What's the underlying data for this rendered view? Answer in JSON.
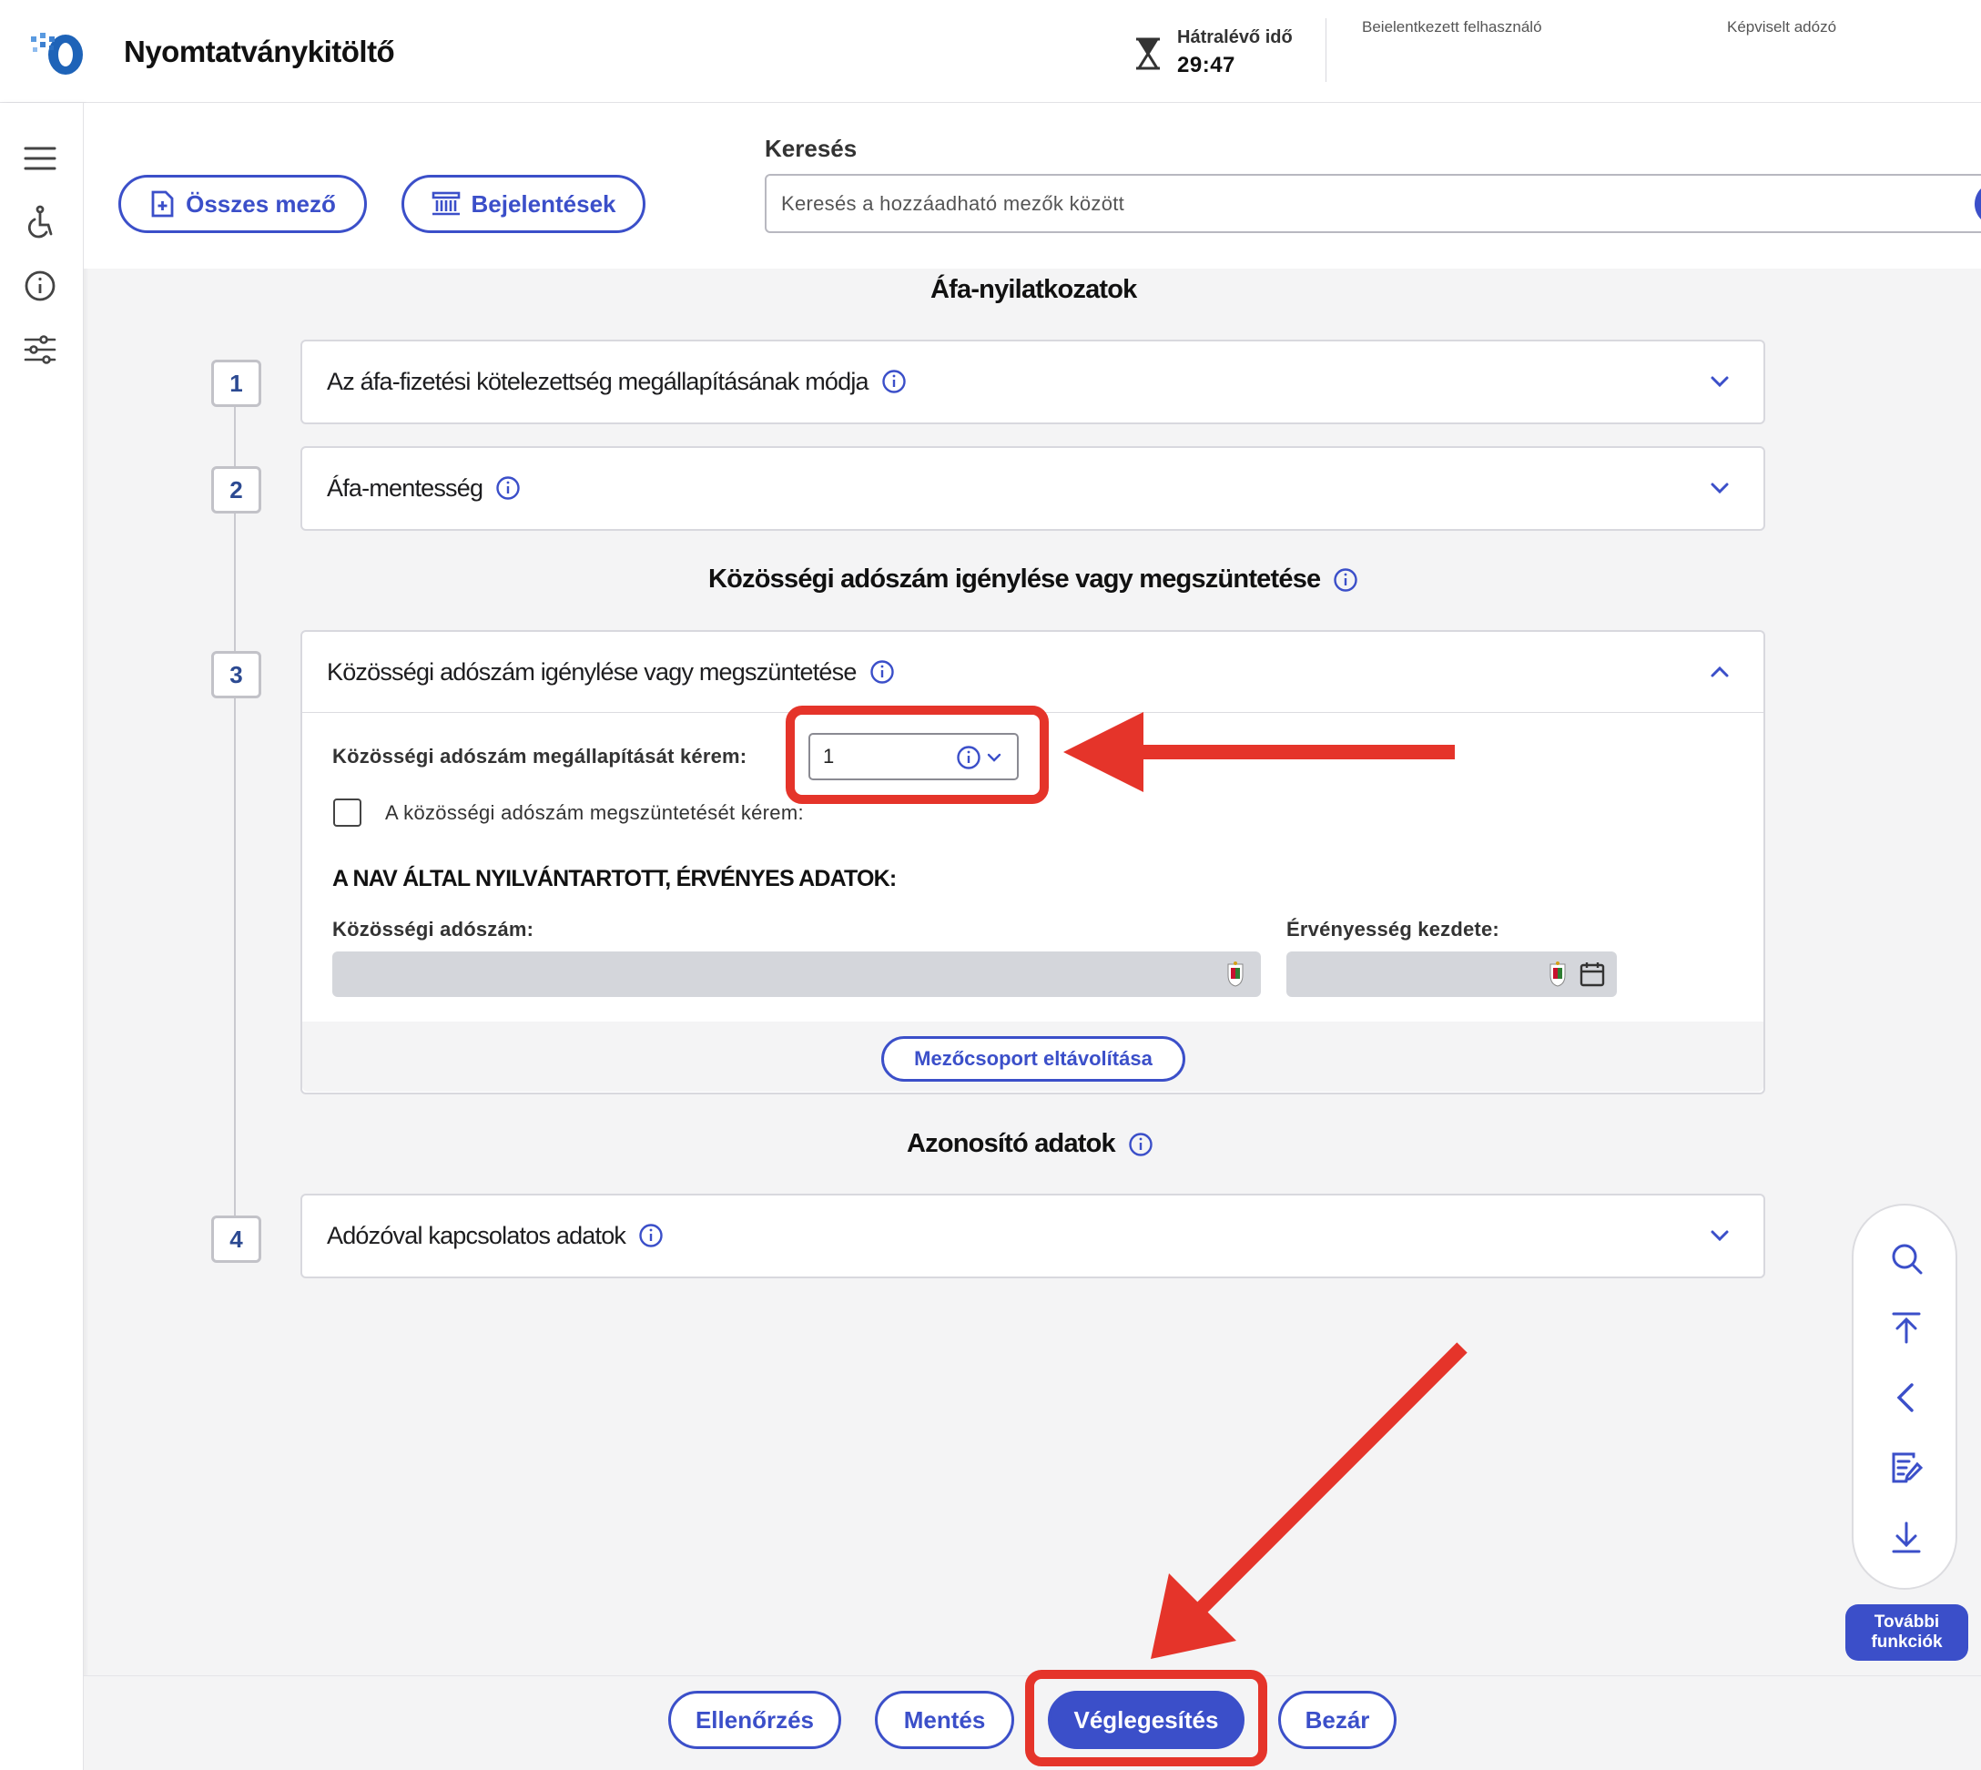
{
  "header": {
    "app_title": "Nyomtatványkitöltő",
    "timer_label": "Hátralévő idő",
    "timer_value": "29:47",
    "logged_in_user_label": "Beielentkezett felhasználó",
    "represented_taxpayer_label": "Képviselt adózó"
  },
  "sidebar": {
    "items": [
      {
        "icon": "menu-icon"
      },
      {
        "icon": "accessibility-icon"
      },
      {
        "icon": "info-icon"
      },
      {
        "icon": "settings-sliders-icon"
      }
    ]
  },
  "toolbar": {
    "all_fields_label": "Összes mező",
    "reports_label": "Bejelentések",
    "search_label": "Keresés",
    "search_placeholder": "Keresés a hozzáadható mezők között"
  },
  "content": {
    "section1_title": "Áfa-nyilatkozatok",
    "cards": [
      {
        "step": "1",
        "title": "Az áfa-fizetési kötelezettség megállapításának módja",
        "expanded": false
      },
      {
        "step": "2",
        "title": "Áfa-mentesség",
        "expanded": false
      },
      {
        "step": "3",
        "title": "Közösségi adószám igénylése vagy megszüntetése",
        "expanded": true
      },
      {
        "step": "4",
        "title": "Adózóval kapcsolatos adatok",
        "expanded": false
      }
    ],
    "section2_title": "Közösségi adószám igénylése vagy megszüntetése",
    "section3_title": "Azonosító adatok",
    "card3": {
      "request_label": "Közösségi adószám megállapítását kérem:",
      "request_value": "1",
      "cancel_label": "A közösségi adószám megszüntetését kérem:",
      "cancel_checked": false,
      "nav_heading": "A NAV ÁLTAL NYILVÁNTARTOTT, ÉRVÉNYES ADATOK:",
      "community_tax_label": "Közösségi adószám:",
      "validity_start_label": "Érvényesség kezdete:",
      "remove_group_label": "Mezőcsoport eltávolítása"
    }
  },
  "float_toolbar": {
    "icons": [
      "search-icon",
      "scroll-top-icon",
      "back-icon",
      "edit-form-icon",
      "download-icon"
    ],
    "more_line1": "További",
    "more_line2": "funkciók"
  },
  "actions": {
    "check_label": "Ellenőrzés",
    "save_label": "Mentés",
    "finalize_label": "Véglegesítés",
    "close_label": "Bezár"
  },
  "colors": {
    "accent": "#3b4fc9",
    "annotation_red": "#e5342a",
    "step_number": "#2c4a92"
  }
}
